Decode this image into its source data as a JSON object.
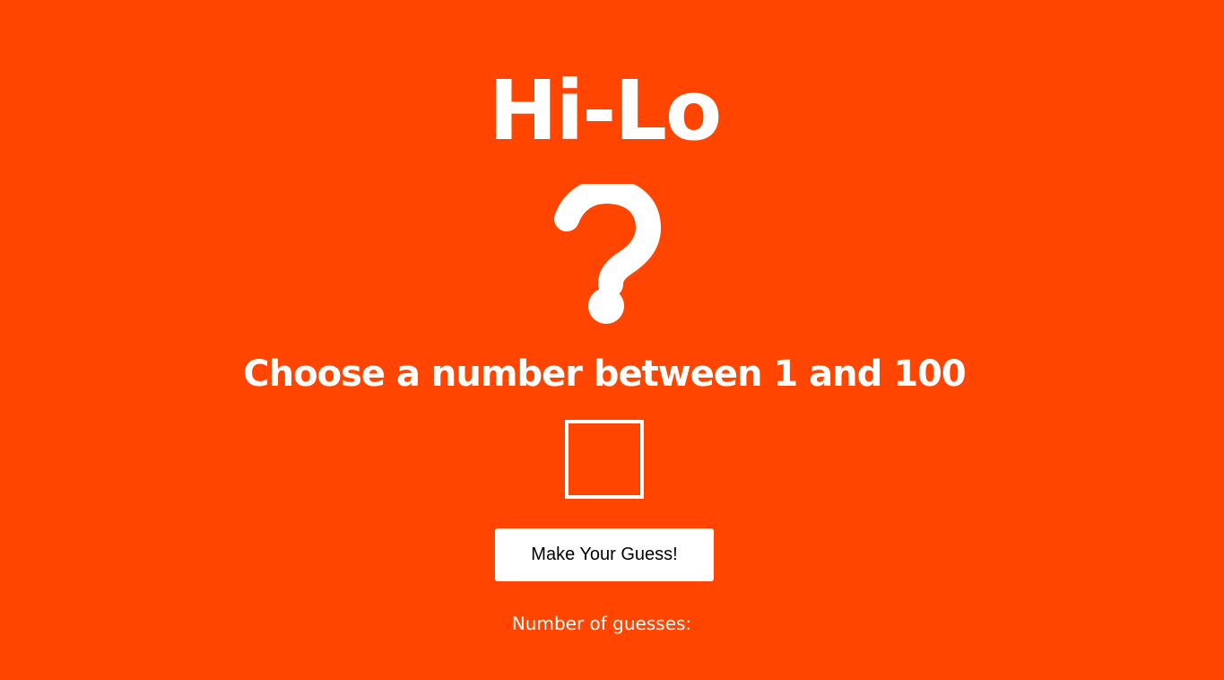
{
  "page": {
    "title": "Hi-Lo",
    "mystery_symbol": "question-mark-icon",
    "prompt": "Choose a number between 1 and 100",
    "guess_input": {
      "value": "",
      "placeholder": ""
    },
    "guess_button_label": "Make Your Guess!",
    "guess_count_label": "Number of guesses:",
    "guess_count_value": ""
  },
  "colors": {
    "background": "#ff4500",
    "foreground": "#ffffff",
    "button_background": "#ffffff",
    "button_text": "#000000"
  }
}
